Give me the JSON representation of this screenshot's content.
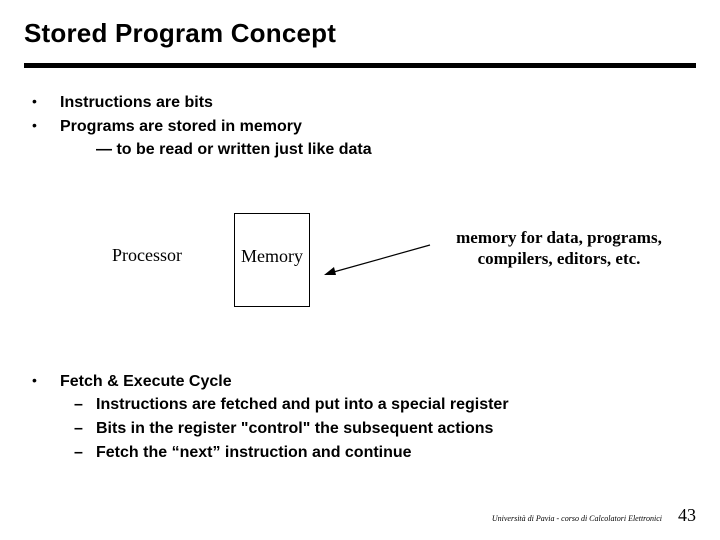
{
  "title": "Stored Program Concept",
  "bullets_top": [
    "Instructions are bits",
    "Programs are stored in memory"
  ],
  "indent_line": "— to be read or written just like data",
  "diagram": {
    "processor_label": "Processor",
    "memory_label": "Memory",
    "note": "memory for data, programs, compilers, editors, etc."
  },
  "cycle": {
    "heading": "Fetch & Execute Cycle",
    "items": [
      "Instructions are fetched and put into a special register",
      "Bits in the register \"control\" the subsequent actions",
      "Fetch the “next” instruction and continue"
    ]
  },
  "footer": {
    "source": "Università di Pavia  - corso di Calcolatori Elettronici",
    "page": "43"
  }
}
